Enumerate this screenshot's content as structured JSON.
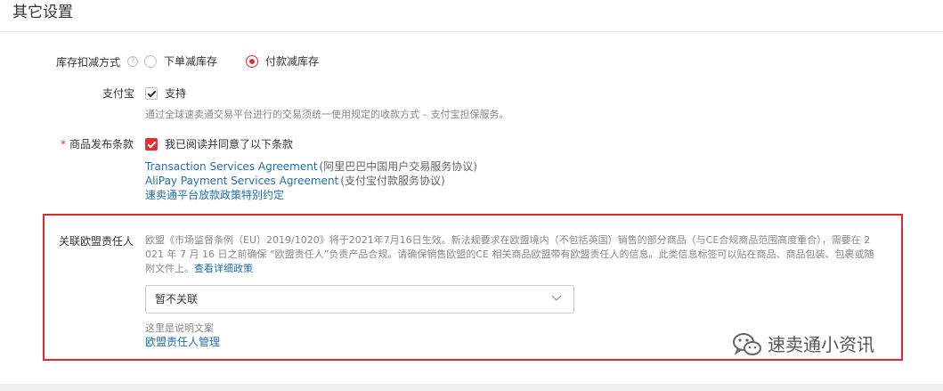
{
  "section": {
    "title": "其它设置"
  },
  "inventory": {
    "label": "库存扣减方式",
    "help_icon": "?",
    "options": [
      "下单减库存",
      "付款减库存"
    ],
    "selected": "付款减库存"
  },
  "alipay": {
    "label": "支付宝",
    "checkbox_label": "支持",
    "checked": true,
    "description": "通过全球速卖通交易平台进行的交易须统一使用规定的收款方式 – 支付宝担保服务。"
  },
  "terms": {
    "required_mark": "*",
    "label": "商品发布条款",
    "checkbox_label": "我已阅读并同意了以下条款",
    "checked": true,
    "links": [
      {
        "text": "Transaction Services Agreement",
        "note": "(阿里巴巴中国用户交易服务协议)"
      },
      {
        "text": "AliPay Payment Services Agreement",
        "note": "(支付宝付款服务协议)"
      },
      {
        "text": "速卖通平台放款政策特别约定",
        "note": ""
      }
    ]
  },
  "eu": {
    "label": "关联欧盟责任人",
    "paragraph": "欧盟《市场监督条例（EU）2019/1020》将于2021年7月16日生效。新法规要求在欧盟境内（不包括英国）销售的部分商品（与CE合规商品范围高度重合），需要在 2021 年 7 月 16 日之前确保 “欧盟责任人”负责产品合规。请确保销售欧盟的CE 相关商品欧盟带有欧盟责任人的信息。此类信息标签可以贴在商品、商品包装、包裹或随附文件上。",
    "policy_link": "查看详细政策",
    "select_value": "暂不关联",
    "hint": "这里是说明文案",
    "manage_link": "欧盟责任人管理"
  },
  "watermark": {
    "text": "速卖通小资讯"
  },
  "colors": {
    "accent": "#e62e2e",
    "link": "#1f6fb2",
    "highlight_border": "#e8262c"
  }
}
